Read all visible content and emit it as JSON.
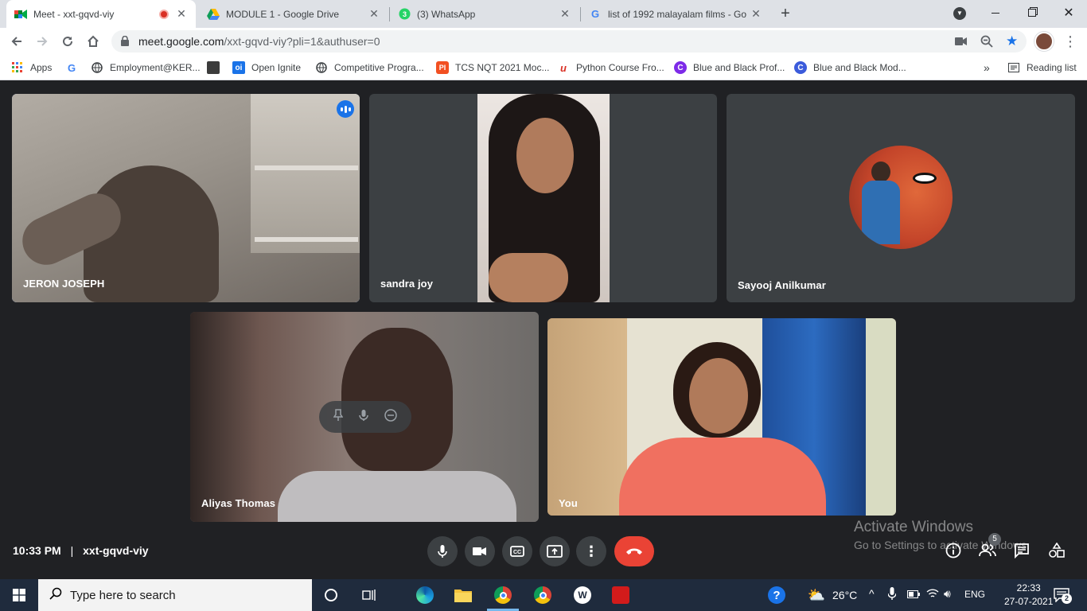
{
  "browser": {
    "tabs": [
      {
        "title": "Meet - xxt-gqvd-viy",
        "active": true
      },
      {
        "title": "MODULE 1 - Google Drive",
        "active": false
      },
      {
        "title": "(3) WhatsApp",
        "active": false
      },
      {
        "title": "list of 1992 malayalam films - Go",
        "active": false
      }
    ],
    "url_host": "meet.google.com",
    "url_path": "/xxt-gqvd-viy?pli=1&authuser=0",
    "bookmarks": [
      {
        "label": "Apps",
        "icon": "apps-grid-icon"
      },
      {
        "label": "",
        "icon": "google-icon"
      },
      {
        "label": "Employment@KER...",
        "icon": "globe-icon"
      },
      {
        "label": "",
        "icon": "image-bookmark-icon"
      },
      {
        "label": "Open Ignite",
        "icon": "oi-icon"
      },
      {
        "label": "Competitive Progra...",
        "icon": "globe-icon"
      },
      {
        "label": "TCS NQT 2021 Moc...",
        "icon": "tcs-icon"
      },
      {
        "label": "Python Course Fro...",
        "icon": "python-course-icon"
      },
      {
        "label": "Blue and Black Prof...",
        "icon": "canva-icon"
      },
      {
        "label": "Blue and Black Mod...",
        "icon": "canva-icon"
      }
    ],
    "reading_list": "Reading list",
    "more_bookmarks": "»"
  },
  "meet": {
    "participants": [
      {
        "name": "JERON JOSEPH",
        "speaking": true
      },
      {
        "name": "sandra joy",
        "speaking": false
      },
      {
        "name": "Sayooj Anilkumar",
        "speaking": false
      },
      {
        "name": "Aliyas Thomas",
        "speaking": false
      },
      {
        "name": "You",
        "speaking": false
      }
    ],
    "time": "10:33 PM",
    "separator": "|",
    "meeting_code": "xxt-gqvd-viy",
    "people_count": "5",
    "activate_windows": {
      "title": "Activate Windows",
      "subtitle": "Go to Settings to activate Windows."
    }
  },
  "taskbar": {
    "search_placeholder": "Type here to search",
    "weather": "26°C",
    "language": "ENG",
    "clock_time": "22:33",
    "clock_date": "27-07-2021",
    "notification_count": "2"
  },
  "colors": {
    "meet_bg": "#202124",
    "tile_bg": "#3c4043",
    "speaking_outline": "#8ab4f8",
    "end_call": "#ea4335",
    "taskbar": "#1f2b3d"
  }
}
